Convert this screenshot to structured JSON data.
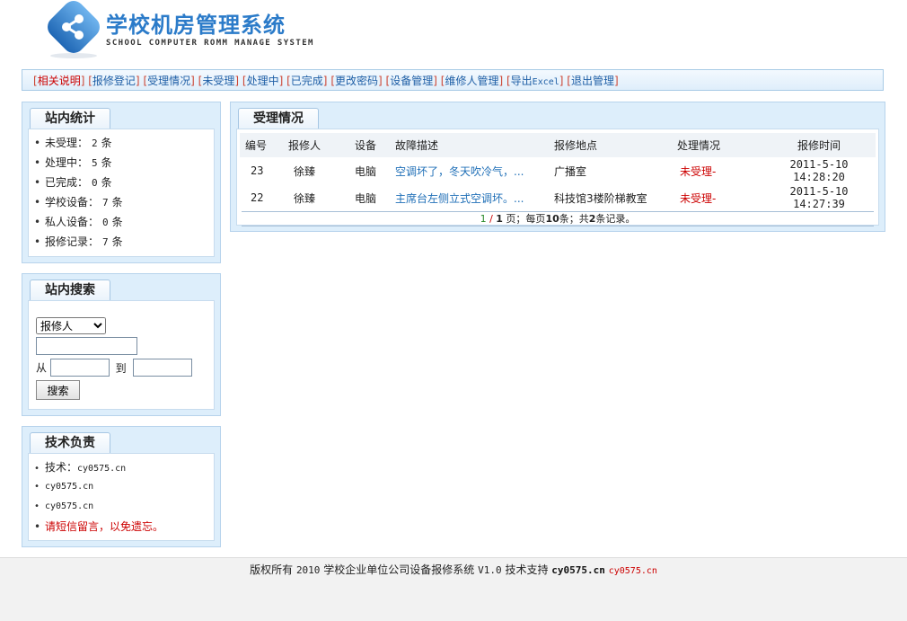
{
  "header": {
    "title_cn": "学校机房管理系统",
    "title_en": "SCHOOL COMPUTER ROMM MANAGE SYSTEM"
  },
  "nav": [
    {
      "label": "相关说明"
    },
    {
      "label": "报修登记"
    },
    {
      "label": "受理情况"
    },
    {
      "label": "未受理"
    },
    {
      "label": "处理中"
    },
    {
      "label": "已完成"
    },
    {
      "label": "更改密码"
    },
    {
      "label": "设备管理"
    },
    {
      "label": "维修人管理"
    },
    {
      "label": "导出",
      "suffix": "Excel"
    },
    {
      "label": "退出管理"
    }
  ],
  "stats_panel": {
    "title": "站内统计",
    "items": [
      {
        "label": "未受理：",
        "value": "2",
        "unit": "条"
      },
      {
        "label": "处理中：",
        "value": "5",
        "unit": "条"
      },
      {
        "label": "已完成：",
        "value": "0",
        "unit": "条"
      },
      {
        "label": "学校设备：",
        "value": "7",
        "unit": "条"
      },
      {
        "label": "私人设备：",
        "value": "0",
        "unit": "条"
      },
      {
        "label": "报修记录：",
        "value": "7",
        "unit": "条"
      }
    ]
  },
  "search_panel": {
    "title": "站内搜索",
    "select_value": "报修人",
    "from_label": "从",
    "to_label": "到",
    "button_label": "搜索"
  },
  "tech_panel": {
    "title": "技术负责",
    "items": [
      {
        "label": "技术：",
        "value": "cy0575.cn"
      },
      {
        "value": "cy0575.cn"
      },
      {
        "value": "cy0575.cn"
      },
      {
        "value": "请短信留言，以免遗忘。"
      }
    ]
  },
  "main_panel": {
    "title": "受理情况",
    "columns": [
      "编号",
      "报修人",
      "设备",
      "故障描述",
      "报修地点",
      "处理情况",
      "报修时间"
    ],
    "rows": [
      {
        "id": "23",
        "reporter": "徐臻",
        "device": "电脑",
        "desc": "空调坏了，冬天吹冷气，...",
        "location": "广播室",
        "status": "未受理-",
        "time": "2011-5-10 14:28:20"
      },
      {
        "id": "22",
        "reporter": "徐臻",
        "device": "电脑",
        "desc": "主席台左侧立式空调坏。...",
        "location": "科技馆3楼阶梯教室",
        "status": "未受理-",
        "time": "2011-5-10 14:27:39"
      }
    ],
    "pager": {
      "current": "1",
      "sep": " / ",
      "total": "1",
      "text1": " 页；每页",
      "per_page": "10",
      "text2": "条；共",
      "count": "2",
      "text3": "条记录。"
    }
  },
  "footer": {
    "text1": "版权所有",
    "year": "2010",
    "text2": "学校企业单位公司设备报修系统",
    "version": "V1.0",
    "text3": "技术支持",
    "link1": "cy0575.cn",
    "link2": "cy0575.cn"
  },
  "colors": {
    "accent": "#2b7bc9",
    "panel_bg": "#ddeefb",
    "link": "#1f5fa6",
    "alert": "#cc0000"
  }
}
